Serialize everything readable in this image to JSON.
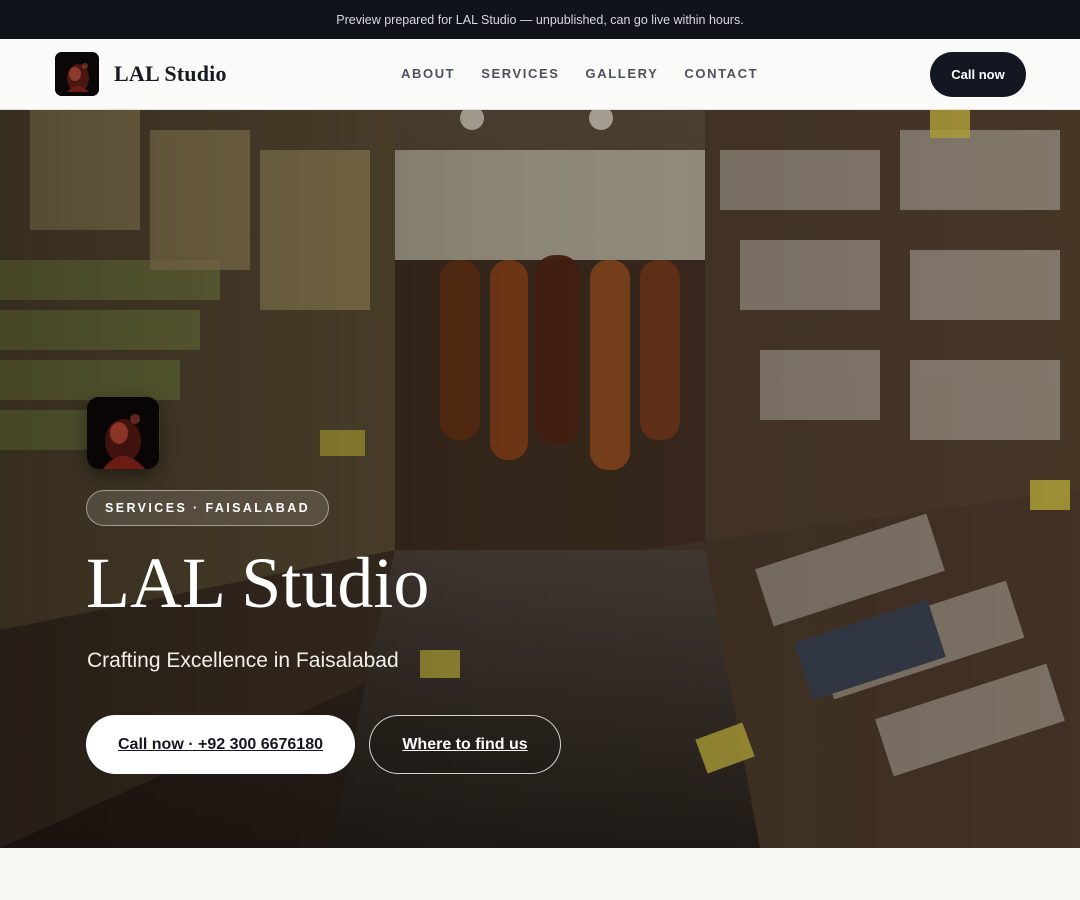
{
  "announcement": "Preview prepared for LAL Studio — unpublished, can go live within hours.",
  "header": {
    "brand_name": "LAL Studio",
    "nav": [
      "ABOUT",
      "SERVICES",
      "GALLERY",
      "CONTACT"
    ],
    "cta_label": "Call now"
  },
  "hero": {
    "badge": "SERVICES · FAISALABAD",
    "title": "LAL Studio",
    "subtitle": "Crafting Excellence in Faisalabad",
    "primary_button": "Call now · +92 300 6676180",
    "secondary_button": "Where to find us"
  },
  "colors": {
    "topbar_bg": "#101319",
    "header_bg": "#fafaf8",
    "cta_dark": "#131722",
    "page_bg": "#f8f7f3"
  }
}
